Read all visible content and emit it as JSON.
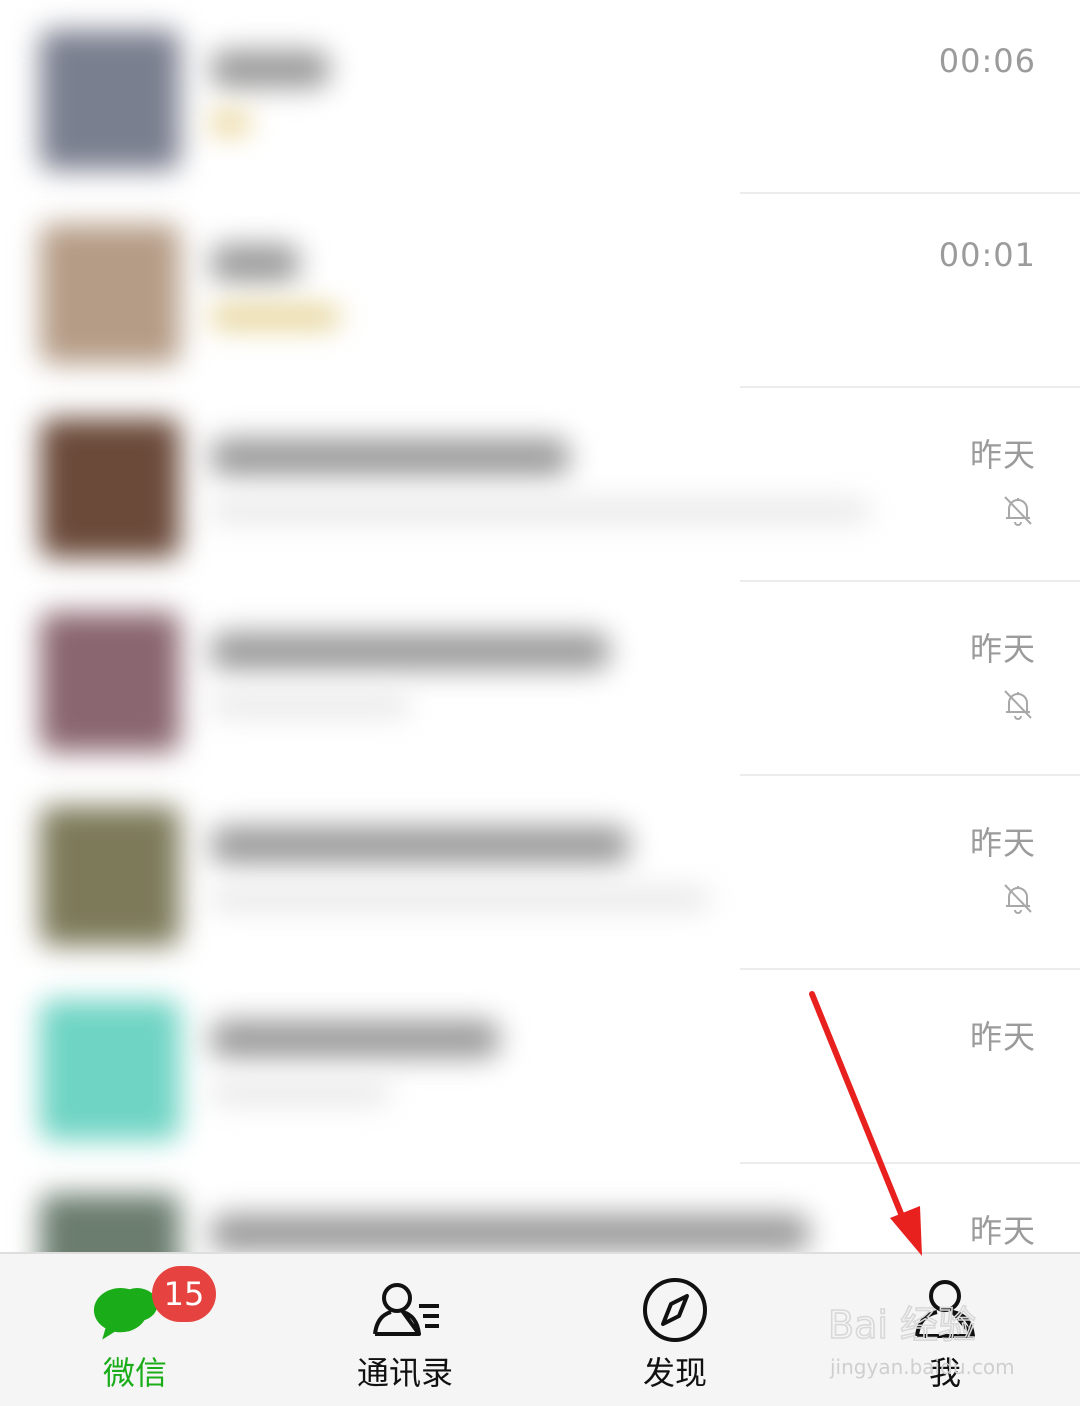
{
  "chats": [
    {
      "time": "00:06",
      "muted": false,
      "avatar_color": "#7a7f8f",
      "name_width": 120,
      "preview_width": 40,
      "preview_color": "#e6cf8a"
    },
    {
      "time": "00:01",
      "muted": false,
      "avatar_color": "#b59c86",
      "name_width": 90,
      "preview_width": 130,
      "preview_color": "#e3cf8c"
    },
    {
      "time": "昨天",
      "muted": true,
      "avatar_color": "#6b4a3a",
      "name_width": 360,
      "preview_width": 660,
      "preview_color": "#e6e6e6"
    },
    {
      "time": "昨天",
      "muted": true,
      "avatar_color": "#8a6670",
      "name_width": 400,
      "preview_width": 200,
      "preview_color": "#e6e6e6"
    },
    {
      "time": "昨天",
      "muted": true,
      "avatar_color": "#7d7a5a",
      "name_width": 420,
      "preview_width": 500,
      "preview_color": "#e6e6e6"
    },
    {
      "time": "昨天",
      "muted": false,
      "avatar_color": "#6fd4c4",
      "name_width": 290,
      "preview_width": 180,
      "preview_color": "#e6e6e6"
    },
    {
      "time": "昨天",
      "muted": false,
      "avatar_color": "#6b7d6f",
      "name_width": 600,
      "preview_width": 0,
      "preview_color": "#e6e6e6"
    }
  ],
  "tabbar": {
    "chats_label": "微信",
    "chats_badge": "15",
    "contacts_label": "通讯录",
    "discover_label": "发现",
    "me_label": "我"
  },
  "colors": {
    "active_tab": "#1aad19",
    "badge": "#e64340",
    "annotation_arrow": "#e8211f"
  },
  "watermark": {
    "brand": "Bai 经验",
    "url": "jingyan.baidu.com"
  }
}
